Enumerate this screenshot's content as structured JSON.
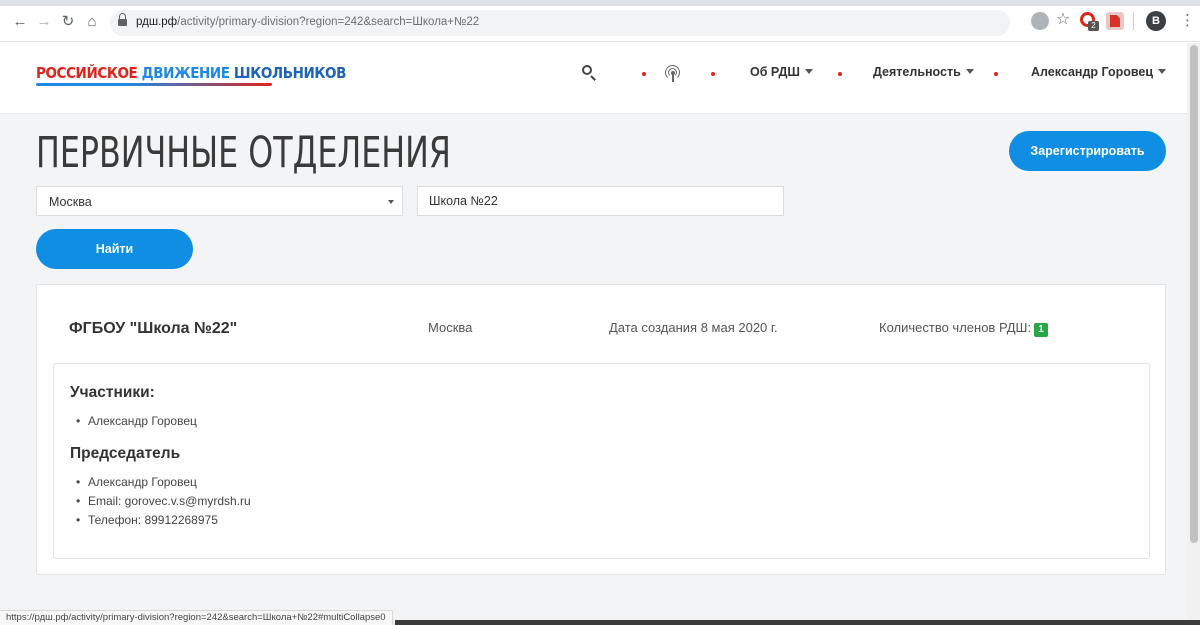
{
  "browser": {
    "url_host": "рдш.рф",
    "url_path": "/activity/primary-division?region=242&search=Школа+№22",
    "profile_initial": "B",
    "extension_badge": "2",
    "status_url": "https://рдш.рф/activity/primary-division?region=242&search=Школа+№22#multiCollapse0",
    "icons": [
      "back-icon",
      "forward-icon",
      "reload-icon",
      "home-icon",
      "lock-icon",
      "star-icon",
      "menu-icon"
    ]
  },
  "header": {
    "logo_words": [
      "Российское",
      "движение",
      "школьников"
    ],
    "menu": {
      "about": "Об РДШ",
      "activity": "Деятельность",
      "user": "Александр Горовец"
    },
    "colors": {
      "logo_red": "#e2231a",
      "logo_blue": "#1e88e5"
    }
  },
  "main": {
    "title": "ПЕРВИЧНЫЕ ОТДЕЛЕНИЯ",
    "register_label": "Зарегистрировать",
    "region_value": "Москва",
    "search_value": "Школа №22",
    "find_label": "Найти",
    "accent_color": "#0f8ee3"
  },
  "result": {
    "name": "ФГБОУ \"Школа №22\"",
    "city": "Москва",
    "created": "Дата создания 8 мая 2020 г.",
    "members_label": "Количество членов РДШ:",
    "members_count": "1",
    "participants_title": "Участники:",
    "participants": [
      "Александр Горовец"
    ],
    "chair_title": "Председатель",
    "chair": [
      "Александр Горовец",
      "Email: gorovec.v.s@myrdsh.ru",
      "Телефон: 89912268975"
    ]
  }
}
